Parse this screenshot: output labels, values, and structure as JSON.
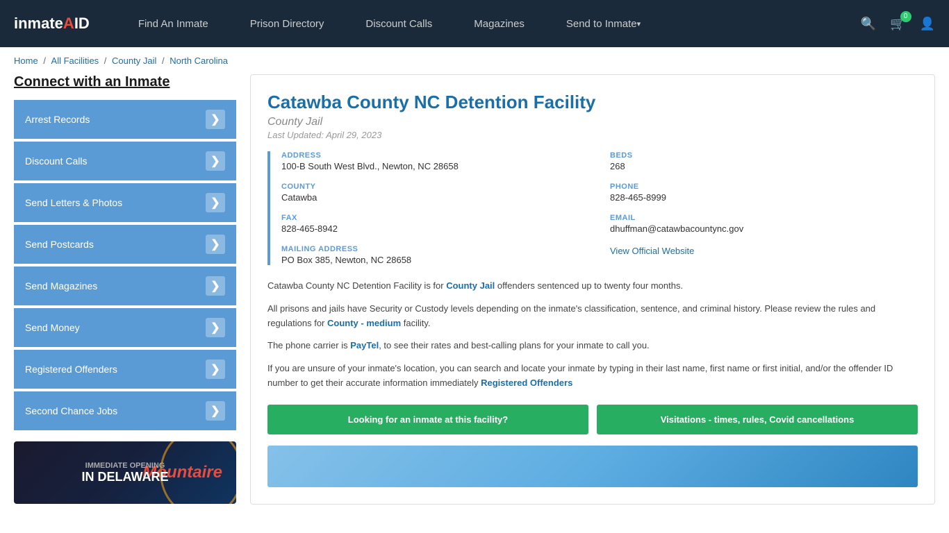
{
  "navbar": {
    "logo": "inmateAID",
    "links": [
      {
        "label": "Find An Inmate",
        "id": "find-inmate",
        "arrow": false
      },
      {
        "label": "Prison Directory",
        "id": "prison-directory",
        "arrow": false
      },
      {
        "label": "Discount Calls",
        "id": "discount-calls",
        "arrow": false
      },
      {
        "label": "Magazines",
        "id": "magazines",
        "arrow": false
      },
      {
        "label": "Send to Inmate",
        "id": "send-to-inmate",
        "arrow": true
      }
    ],
    "cart_count": "0"
  },
  "breadcrumb": {
    "items": [
      "Home",
      "All Facilities",
      "County Jail",
      "North Carolina"
    ]
  },
  "sidebar": {
    "title": "Connect with an Inmate",
    "menu_items": [
      {
        "label": "Arrest Records",
        "id": "arrest-records"
      },
      {
        "label": "Discount Calls",
        "id": "discount-calls"
      },
      {
        "label": "Send Letters & Photos",
        "id": "send-letters"
      },
      {
        "label": "Send Postcards",
        "id": "send-postcards"
      },
      {
        "label": "Send Magazines",
        "id": "send-magazines"
      },
      {
        "label": "Send Money",
        "id": "send-money"
      },
      {
        "label": "Registered Offenders",
        "id": "registered-offenders"
      },
      {
        "label": "Second Chance Jobs",
        "id": "second-chance-jobs"
      }
    ],
    "banner": {
      "line1": "IMMEDIATE OPENING",
      "line2": "IN DELAWARE",
      "logo": "Mountaire"
    }
  },
  "facility": {
    "title": "Catawba County NC Detention Facility",
    "type": "County Jail",
    "last_updated": "Last Updated: April 29, 2023",
    "address_label": "ADDRESS",
    "address_value": "100-B South West Blvd., Newton, NC 28658",
    "beds_label": "BEDS",
    "beds_value": "268",
    "county_label": "COUNTY",
    "county_value": "Catawba",
    "phone_label": "PHONE",
    "phone_value": "828-465-8999",
    "fax_label": "FAX",
    "fax_value": "828-465-8942",
    "email_label": "EMAIL",
    "email_value": "dhuffman@catawbacountync.gov",
    "mailing_label": "MAILING ADDRESS",
    "mailing_value": "PO Box 385, Newton, NC 28658",
    "website_label": "View Official Website",
    "desc1": "Catawba County NC Detention Facility is for ",
    "desc1_link": "County Jail",
    "desc1_rest": " offenders sentenced up to twenty four months.",
    "desc2": "All prisons and jails have Security or Custody levels depending on the inmate's classification, sentence, and criminal history. Please review the rules and regulations for ",
    "desc2_link": "County - medium",
    "desc2_rest": " facility.",
    "desc3": "The phone carrier is ",
    "desc3_link": "PayTel",
    "desc3_rest": ", to see their rates and best-calling plans for your inmate to call you.",
    "desc4": "If you are unsure of your inmate's location, you can search and locate your inmate by typing in their last name, first name or first initial, and/or the offender ID number to get their accurate information immediately ",
    "desc4_link": "Registered Offenders",
    "btn1": "Looking for an inmate at this facility?",
    "btn2": "Visitations - times, rules, Covid cancellations"
  }
}
